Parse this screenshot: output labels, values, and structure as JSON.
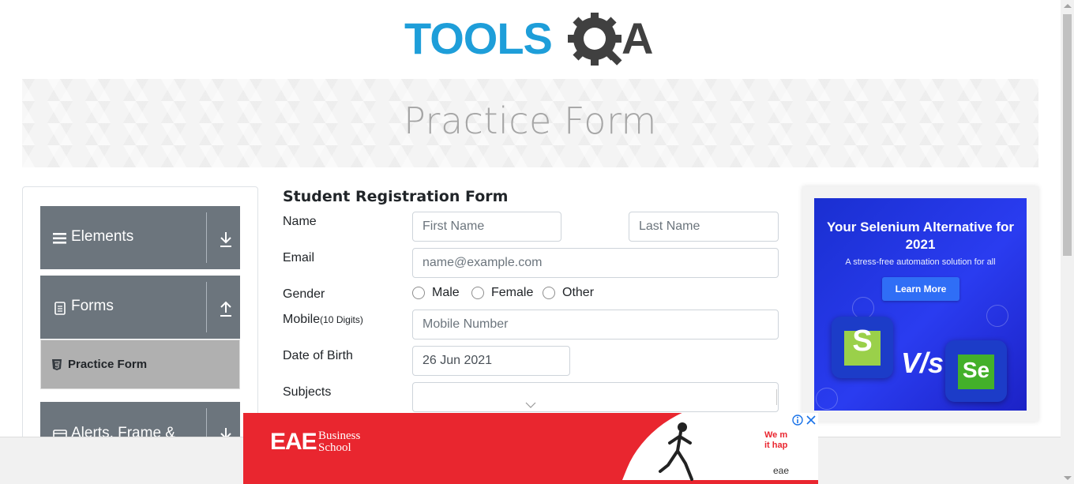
{
  "logo": {
    "text_tools": "TOOLS",
    "text_a": "A",
    "alt": "ToolsQA logo"
  },
  "banner": {
    "title": "Practice Form"
  },
  "sidebar": {
    "groups": [
      {
        "label": "Elements",
        "icon": "list-icon",
        "arrow": "arrow-down-icon"
      },
      {
        "label": "Forms",
        "icon": "document-icon",
        "arrow": "arrow-up-icon"
      },
      {
        "label": "Alerts, Frame & Windows",
        "icon": "window-icon",
        "arrow": "arrow-down-icon"
      }
    ],
    "active_item": {
      "label": "Practice Form",
      "icon": "html5-icon"
    }
  },
  "form": {
    "title": "Student Registration Form",
    "name_label": "Name",
    "first_name_placeholder": "First Name",
    "last_name_placeholder": "Last Name",
    "email_label": "Email",
    "email_placeholder": "name@example.com",
    "gender_label": "Gender",
    "gender_options": [
      "Male",
      "Female",
      "Other"
    ],
    "mobile_label": "Mobile",
    "mobile_hint": "(10 Digits)",
    "mobile_placeholder": "Mobile Number",
    "dob_label": "Date of Birth",
    "dob_value": "26 Jun 2021",
    "subjects_label": "Subjects",
    "subjects_value": ""
  },
  "ad_right": {
    "headline": "Your Selenium Alternative for 2021",
    "subline": "A stress-free automation solution for all",
    "button": "Learn More",
    "vs": "V/s",
    "logo_s": "S",
    "logo_se": "Se"
  },
  "ad_bottom": {
    "brand": "EAE",
    "brand_sub_1": "Business",
    "brand_sub_2": "School",
    "tag_1": "We m",
    "tag_2": "it hap",
    "site": "eae"
  },
  "colors": {
    "sidebar_group": "#6c757d",
    "active_item": "#b0b0b0",
    "logo_blue": "#1e9ed9",
    "logo_dark": "#404040",
    "ad_blue": "#1a2fd1",
    "ad_red": "#e9262f"
  }
}
